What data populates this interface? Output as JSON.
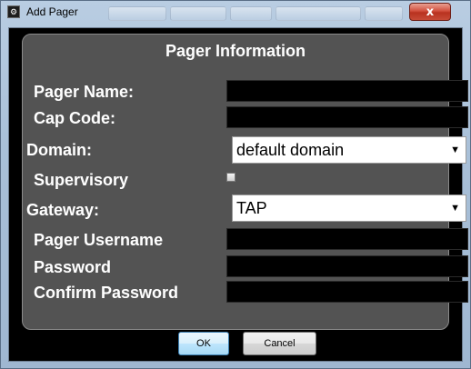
{
  "window": {
    "title": "Add Pager",
    "close_glyph": "x"
  },
  "form": {
    "heading": "Pager Information",
    "labels": {
      "pager_name": "Pager Name:",
      "cap_code": "Cap Code:",
      "domain": "Domain:",
      "supervisory": "Supervisory",
      "gateway": "Gateway:",
      "pager_username": "Pager Username",
      "password": "Password",
      "confirm_password": "Confirm Password"
    },
    "values": {
      "pager_name": "",
      "cap_code": "",
      "domain": "default domain",
      "supervisory_checked": false,
      "gateway": "TAP",
      "pager_username": "",
      "password": "",
      "confirm_password": ""
    }
  },
  "buttons": {
    "ok": "OK",
    "cancel": "Cancel"
  },
  "icons": {
    "app": "app-icon",
    "dropdown": "chevron-down-icon"
  },
  "colors": {
    "panel": "#535353",
    "background": "#000000",
    "close": "#c74b37"
  }
}
